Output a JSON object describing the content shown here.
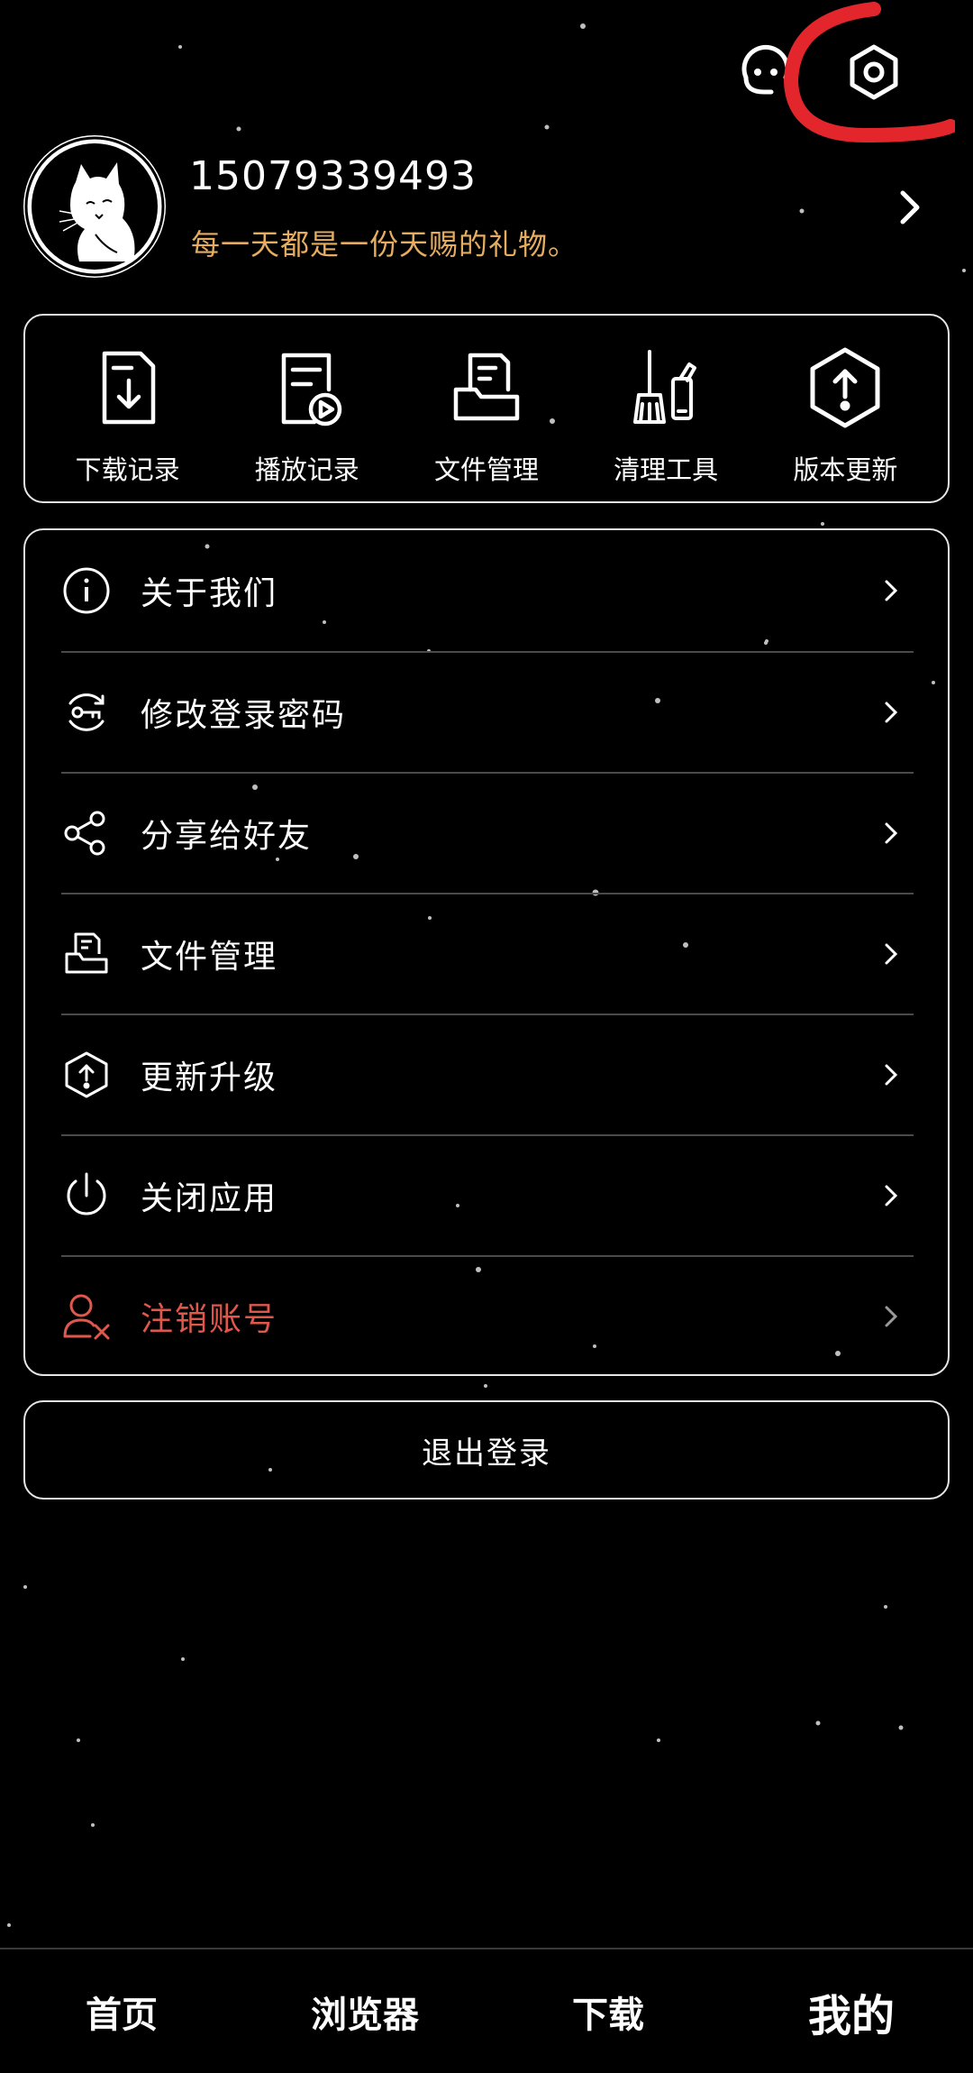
{
  "header": {
    "icons": [
      "robot-face-icon",
      "settings-hexagon-icon"
    ]
  },
  "profile": {
    "username": "15079339493",
    "motto": "每一天都是一份天赐的礼物。"
  },
  "quick_actions": [
    {
      "label": "下载记录",
      "icon": "download-record-icon"
    },
    {
      "label": "播放记录",
      "icon": "play-record-icon"
    },
    {
      "label": "文件管理",
      "icon": "file-manage-icon"
    },
    {
      "label": "清理工具",
      "icon": "broom-cleanup-icon"
    },
    {
      "label": "版本更新",
      "icon": "upload-hexagon-icon"
    }
  ],
  "menu": [
    {
      "label": "关于我们",
      "icon": "info-icon"
    },
    {
      "label": "修改登录密码",
      "icon": "key-icon"
    },
    {
      "label": "分享给好友",
      "icon": "share-icon"
    },
    {
      "label": "文件管理",
      "icon": "file-drawer-icon"
    },
    {
      "label": "更新升级",
      "icon": "upgrade-icon"
    },
    {
      "label": "关闭应用",
      "icon": "power-icon"
    },
    {
      "label": "注销账号",
      "icon": "delete-user-icon"
    }
  ],
  "logout_label": "退出登录",
  "bottom_nav": [
    {
      "label": "首页"
    },
    {
      "label": "浏览器"
    },
    {
      "label": "下载"
    },
    {
      "label": "我的",
      "active": true
    }
  ],
  "colors": {
    "background": "#000000",
    "motto": "#e6ad61",
    "danger": "#e0574c",
    "annotation": "#e3262b",
    "card_border": "#e5e5e5"
  }
}
